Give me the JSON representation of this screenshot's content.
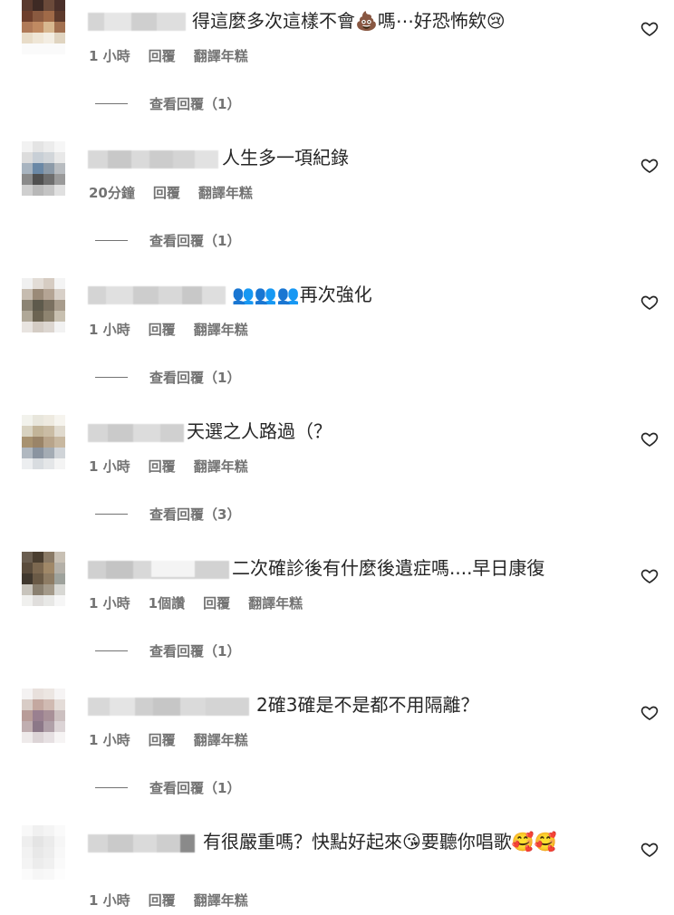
{
  "comments": [
    {
      "text": "得這麼多次這樣不會💩嗎⋯好恐怖欸😢",
      "time": "1 小時",
      "likes": "",
      "reply_label": "回覆",
      "translate_label": "翻譯年糕",
      "view_replies": "查看回覆（1）"
    },
    {
      "text": "人生多一項紀錄",
      "time": "20分鐘",
      "likes": "",
      "reply_label": "回覆",
      "translate_label": "翻譯年糕",
      "view_replies": "查看回覆（1）"
    },
    {
      "text": "👥👥👥再次強化",
      "time": "1 小時",
      "likes": "",
      "reply_label": "回覆",
      "translate_label": "翻譯年糕",
      "view_replies": "查看回覆（1）"
    },
    {
      "text": "天選之人路過（？",
      "time": "1 小時",
      "likes": "",
      "reply_label": "回覆",
      "translate_label": "翻譯年糕",
      "view_replies": "查看回覆（3）"
    },
    {
      "text": "二次確診後有什麼後遺症嗎....早日康復",
      "time": "1 小時",
      "likes": "1個讚",
      "reply_label": "回覆",
      "translate_label": "翻譯年糕",
      "view_replies": "查看回覆（1）"
    },
    {
      "text": "2確3確是不是都不用隔離？",
      "time": "1 小時",
      "likes": "",
      "reply_label": "回覆",
      "translate_label": "翻譯年糕",
      "view_replies": "查看回覆（1）"
    },
    {
      "text": "有很嚴重嗎？快點好起來😘要聽你唱歌🥰🥰",
      "time": "1 小時",
      "likes": "",
      "reply_label": "回覆",
      "translate_label": "翻譯年糕",
      "view_replies": ""
    }
  ],
  "colors": {
    "text": "#262626",
    "secondary": "#737373"
  },
  "icons": {
    "like": "heart-outline-icon"
  }
}
